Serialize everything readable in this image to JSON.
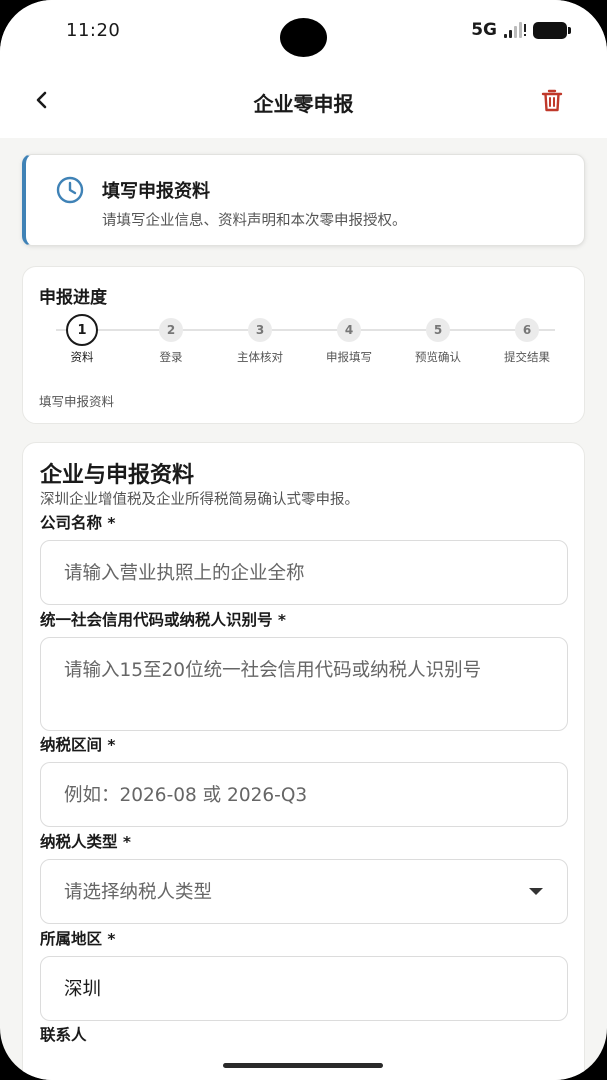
{
  "status_bar": {
    "time": "11:20",
    "network": "5G",
    "icons": [
      "signal-icon",
      "battery-icon"
    ]
  },
  "header": {
    "title": "企业零申报",
    "back_icon": "chevron-left-icon",
    "delete_icon": "trash-icon",
    "accent_color": "#c0392b"
  },
  "info_card": {
    "icon": "clock-icon",
    "title": "填写申报资料",
    "description": "请填写企业信息、资料声明和本次零申报授权。",
    "accent_color": "#3f82b6"
  },
  "progress": {
    "title": "申报进度",
    "current_step": 1,
    "current_label": "填写申报资料",
    "steps": [
      {
        "number": "1",
        "label": "资料"
      },
      {
        "number": "2",
        "label": "登录"
      },
      {
        "number": "3",
        "label": "主体核对"
      },
      {
        "number": "4",
        "label": "申报填写"
      },
      {
        "number": "5",
        "label": "预览确认"
      },
      {
        "number": "6",
        "label": "提交结果"
      }
    ]
  },
  "form": {
    "title": "企业与申报资料",
    "subtitle": "深圳企业增值税及企业所得税简易确认式零申报。",
    "fields": [
      {
        "label": "公司名称 *",
        "placeholder": "请输入营业执照上的企业全称",
        "value": ""
      },
      {
        "label": "统一社会信用代码或纳税人识别号 *",
        "placeholder": "请输入15至20位统一社会信用代码或纳税人识别号",
        "value": ""
      },
      {
        "label": "纳税区间 *",
        "placeholder": "例如：2026-08 或 2026-Q3",
        "value": ""
      },
      {
        "label": "纳税人类型 *",
        "placeholder": "请选择纳税人类型",
        "value": ""
      },
      {
        "label": "所属地区 *",
        "placeholder": "",
        "value": "深圳"
      },
      {
        "label": "联系人",
        "placeholder": "",
        "value": ""
      }
    ]
  }
}
